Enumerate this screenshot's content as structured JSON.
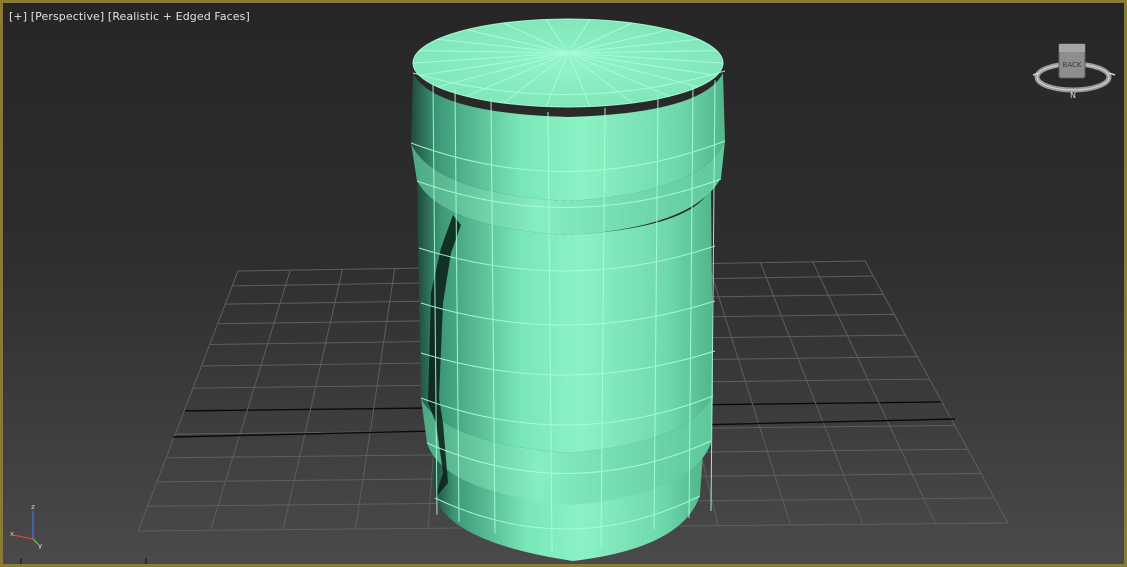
{
  "viewport": {
    "menu_label": "[+]",
    "view_label": "[Perspective]",
    "shading_label": "[Realistic + Edged Faces]"
  },
  "viewcube": {
    "face_label": "BACK",
    "compass_label": "N"
  },
  "axis_tripod": {
    "x_label": "x",
    "y_label": "y",
    "z_label": "z"
  },
  "colors": {
    "frame": "#8a7a35",
    "mesh": "#6ee6b0",
    "wire": "#a0ffd0",
    "grid": "#5e5e5e",
    "grid_axis": "#0a0a0a"
  },
  "icons": [
    "viewcube-icon",
    "axis-tripod-icon"
  ]
}
